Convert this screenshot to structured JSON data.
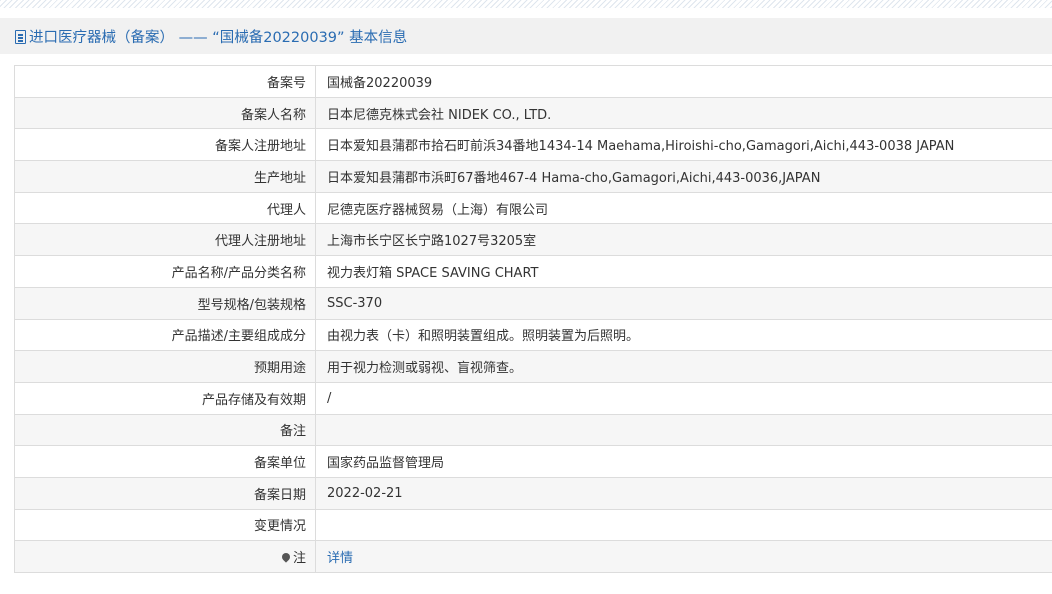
{
  "header": {
    "title": "进口医疗器械（备案） —— “国械备20220039” 基本信息"
  },
  "rows": [
    {
      "label": "备案号",
      "value": "国械备20220039"
    },
    {
      "label": "备案人名称",
      "value": "日本尼德克株式会社 NIDEK CO., LTD."
    },
    {
      "label": "备案人注册地址",
      "value": "日本爱知县蒲郡市拾石町前浜34番地1434-14 Maehama,Hiroishi-cho,Gamagori,Aichi,443-0038 JAPAN"
    },
    {
      "label": "生产地址",
      "value": "日本爱知县蒲郡市浜町67番地467-4 Hama-cho,Gamagori,Aichi,443-0036,JAPAN"
    },
    {
      "label": "代理人",
      "value": "尼德克医疗器械贸易（上海）有限公司"
    },
    {
      "label": "代理人注册地址",
      "value": "上海市长宁区长宁路1027号3205室"
    },
    {
      "label": "产品名称/产品分类名称",
      "value": "视力表灯箱 SPACE SAVING CHART"
    },
    {
      "label": "型号规格/包装规格",
      "value": "SSC-370"
    },
    {
      "label": "产品描述/主要组成成分",
      "value": "由视力表（卡）和照明装置组成。照明装置为后照明。"
    },
    {
      "label": "预期用途",
      "value": "用于视力检测或弱视、盲视筛查。"
    },
    {
      "label": "产品存储及有效期",
      "value": "/"
    },
    {
      "label": "备注",
      "value": ""
    },
    {
      "label": "备案单位",
      "value": "国家药品监督管理局"
    },
    {
      "label": "备案日期",
      "value": "2022-02-21"
    },
    {
      "label": "变更情况",
      "value": ""
    }
  ],
  "note_row": {
    "label": "注",
    "link_text": "详情"
  }
}
